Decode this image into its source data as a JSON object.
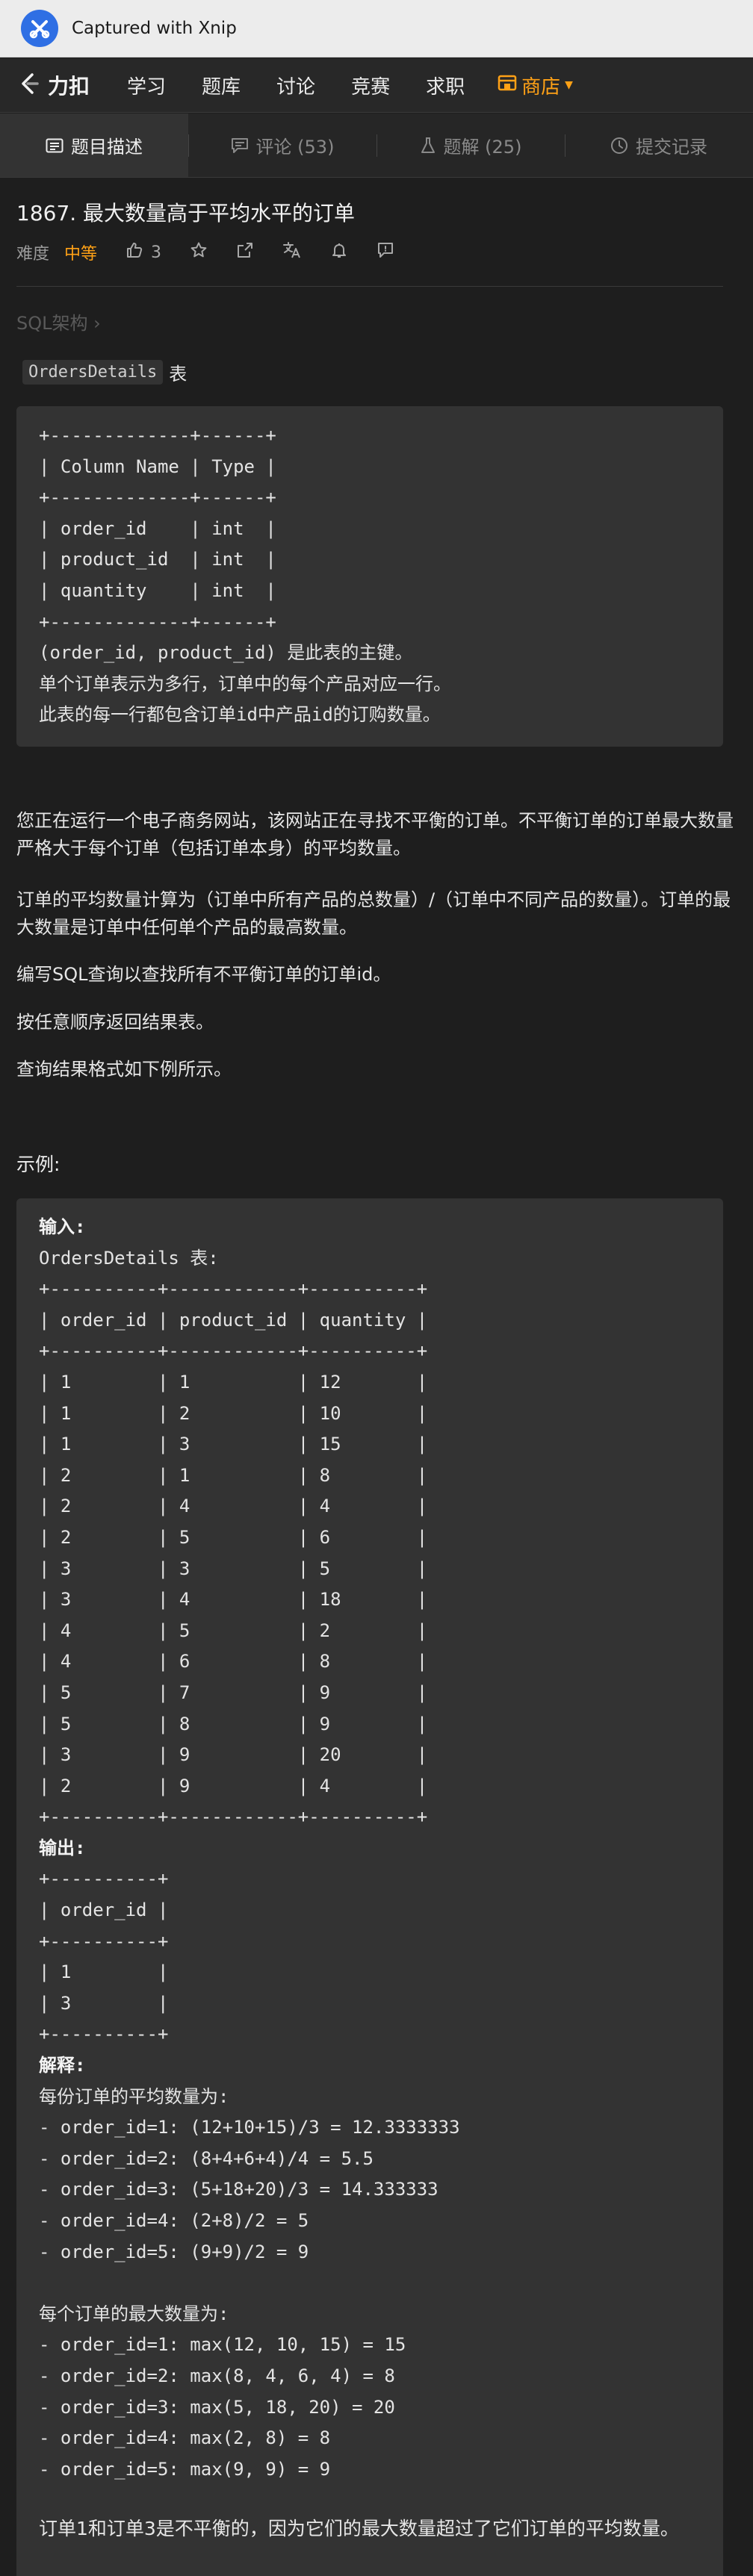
{
  "capture": {
    "title": "Captured with Xnip"
  },
  "nav": {
    "brand": "力扣",
    "links": [
      "学习",
      "题库",
      "讨论",
      "竞赛",
      "求职"
    ],
    "shop": "商店"
  },
  "tabs": [
    {
      "label": "题目描述",
      "icon": "description-icon"
    },
    {
      "label": "评论 (53)",
      "icon": "comment-icon"
    },
    {
      "label": "题解 (25)",
      "icon": "flask-icon"
    },
    {
      "label": "提交记录",
      "icon": "clock-icon"
    }
  ],
  "question": {
    "title": "1867. 最大数量高于平均水平的订单",
    "difficulty_label": "难度",
    "difficulty": "中等",
    "likes": "3",
    "breadcrumb": "SQL架构 ›",
    "table_name": "OrdersDetails",
    "table_suffix": "表"
  },
  "schema_code": "+-------------+------+\n| Column Name | Type |\n+-------------+------+\n| order_id    | int  |\n| product_id  | int  |\n| quantity    | int  |\n+-------------+------+\n(order_id, product_id) 是此表的主键。\n单个订单表示为多行，订单中的每个产品对应一行。\n此表的每一行都包含订单id中产品id的订购数量。",
  "description": [
    "您正在运行一个电子商务网站，该网站正在寻找不平衡的订单。不平衡订单的订单最大数量严格大于每个订单（包括订单本身）的平均数量。",
    "订单的平均数量计算为（订单中所有产品的总数量）/（订单中不同产品的数量）。订单的最大数量是订单中任何单个产品的最高数量。",
    "编写SQL查询以查找所有不平衡订单的订单id。",
    "按任意顺序返回结果表。",
    "查询结果格式如下例所示。"
  ],
  "example": {
    "label": "示例:",
    "input_label": "输入:",
    "input_code": "OrdersDetails 表:\n+----------+------------+----------+\n| order_id | product_id | quantity |\n+----------+------------+----------+\n| 1        | 1          | 12       |\n| 1        | 2          | 10       |\n| 1        | 3          | 15       |\n| 2        | 1          | 8        |\n| 2        | 4          | 4        |\n| 2        | 5          | 6        |\n| 3        | 3          | 5        |\n| 3        | 4          | 18       |\n| 4        | 5          | 2        |\n| 4        | 6          | 8        |\n| 5        | 7          | 9        |\n| 5        | 8          | 9        |\n| 3        | 9          | 20       |\n| 2        | 9          | 4        |\n+----------+------------+----------+",
    "output_label": "输出:",
    "output_code": "+----------+\n| order_id |\n+----------+\n| 1        |\n| 3        |\n+----------+",
    "explain_label": "解释:",
    "explain_code": "每份订单的平均数量为:\n- order_id=1: (12+10+15)/3 = 12.3333333\n- order_id=2: (8+4+6+4)/4 = 5.5\n- order_id=3: (5+18+20)/3 = 14.333333\n- order_id=4: (2+8)/2 = 5\n- order_id=5: (9+9)/2 = 9\n\n每个订单的最大数量为:\n- order_id=1: max(12, 10, 15) = 15\n- order_id=2: max(8, 4, 6, 4) = 8\n- order_id=3: max(5, 18, 20) = 20\n- order_id=4: max(2, 8) = 8\n- order_id=5: max(9, 9) = 9",
    "conclusion": "订单1和订单3是不平衡的，因为它们的最大数量超过了它们订单的平均数量。"
  },
  "colors": {
    "accent": "#ffa116",
    "background": "#1e1e1e",
    "code_bg": "#333333"
  }
}
